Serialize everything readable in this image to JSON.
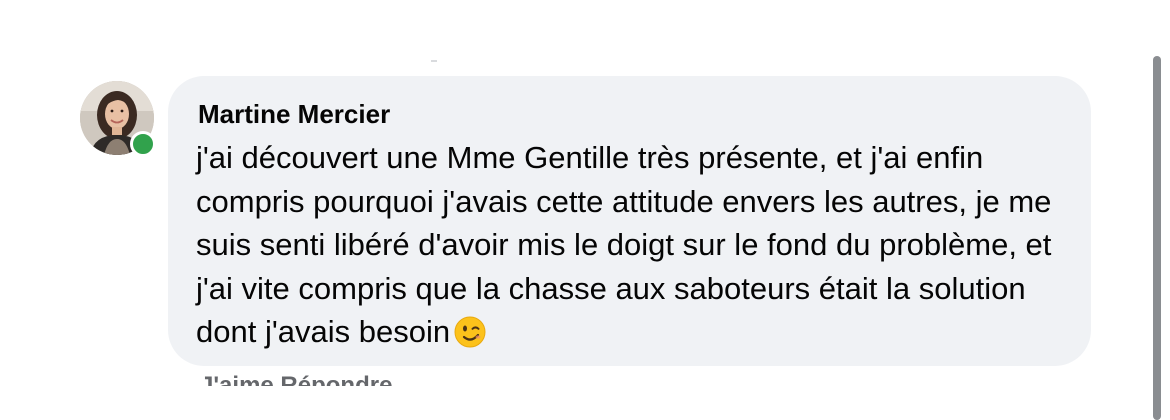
{
  "comment": {
    "author": "Martine Mercier",
    "text": "j'ai découvert une Mme Gentille très présente, et j'ai enfin compris pourquoi j'avais cette attitude envers les autres, je me suis senti libéré d'avoir mis le doigt sur le fond du problème, et j'ai vite compris que la chasse aux saboteurs était la solution dont j'avais besoin",
    "emoji": "winking-face",
    "online_status_color": "#31a24c"
  },
  "actions": {
    "cutoff_text": "J'aime   Répondre   "
  },
  "colors": {
    "bubble_background": "#f0f2f5",
    "text": "#050505",
    "secondary_text": "#65676b"
  }
}
